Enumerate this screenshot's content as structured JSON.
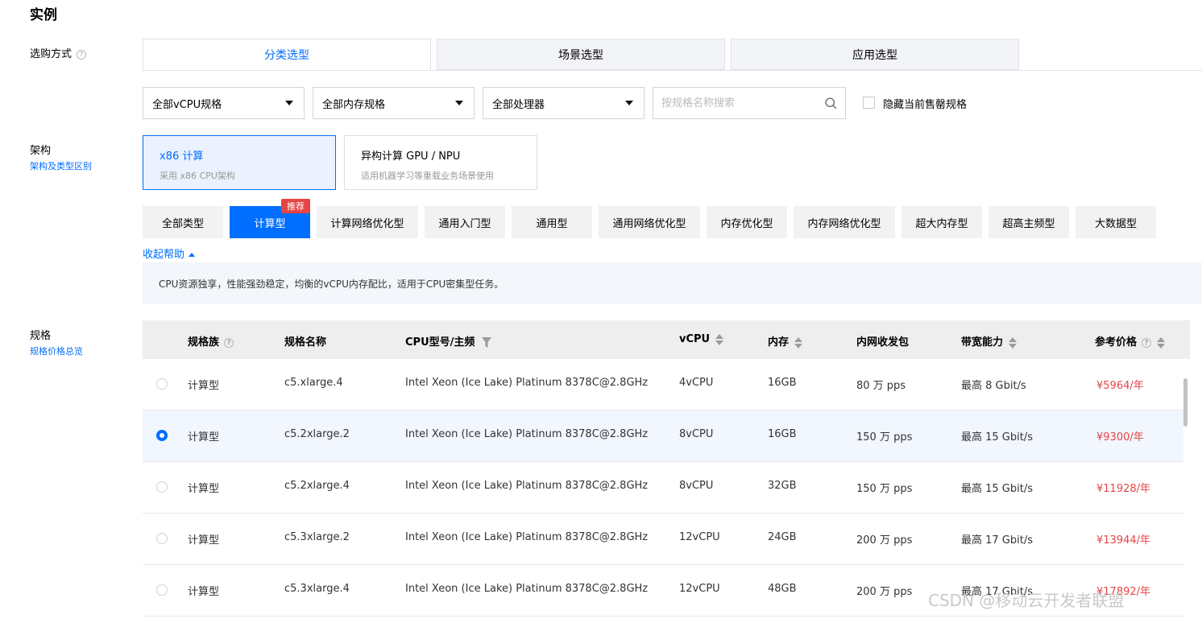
{
  "page_title": "实例",
  "purchase_mode": {
    "label": "选购方式",
    "help_icon": "question-circle-icon",
    "tabs": [
      {
        "label": "分类选型",
        "active": true
      },
      {
        "label": "场景选型",
        "active": false
      },
      {
        "label": "应用选型",
        "active": false
      }
    ]
  },
  "filters": {
    "vcpu": "全部vCPU规格",
    "memory": "全部内存规格",
    "processor": "全部处理器",
    "search_placeholder": "按规格名称搜索",
    "hide_sold_out": "隐藏当前售罄规格"
  },
  "architecture": {
    "label": "架构",
    "link": "架构及类型区别",
    "cards": [
      {
        "title": "x86 计算",
        "desc": "采用 x86 CPU架构",
        "active": true
      },
      {
        "title": "异构计算 GPU / NPU",
        "desc": "适用机器学习等重载业务场景使用",
        "active": false
      }
    ]
  },
  "types": {
    "badge": "推荐",
    "items": [
      "全部类型",
      "计算型",
      "计算网络优化型",
      "通用入门型",
      "通用型",
      "通用网络优化型",
      "内存优化型",
      "内存网络优化型",
      "超大内存型",
      "超高主频型",
      "大数据型"
    ],
    "active_index": 1,
    "collapse_help": "收起帮助",
    "help_text": "CPU资源独享，性能强劲稳定，均衡的vCPU内存配比，适用于CPU密集型任务。"
  },
  "spec": {
    "label": "规格",
    "link": "规格价格总览",
    "columns": [
      "规格族",
      "规格名称",
      "CPU型号/主频",
      "vCPU",
      "内存",
      "内网收发包",
      "带宽能力",
      "参考价格"
    ],
    "rows": [
      {
        "family": "计算型",
        "name": "c5.xlarge.4",
        "cpu": "Intel Xeon (Ice Lake) Platinum 8378C@2.8GHz",
        "vcpu": "4vCPU",
        "mem": "16GB",
        "pps": "80 万 pps",
        "bw": "最高 8 Gbit/s",
        "price": "¥5964/年",
        "selected": false
      },
      {
        "family": "计算型",
        "name": "c5.2xlarge.2",
        "cpu": "Intel Xeon (Ice Lake) Platinum 8378C@2.8GHz",
        "vcpu": "8vCPU",
        "mem": "16GB",
        "pps": "150 万 pps",
        "bw": "最高 15 Gbit/s",
        "price": "¥9300/年",
        "selected": true
      },
      {
        "family": "计算型",
        "name": "c5.2xlarge.4",
        "cpu": "Intel Xeon (Ice Lake) Platinum 8378C@2.8GHz",
        "vcpu": "8vCPU",
        "mem": "32GB",
        "pps": "150 万 pps",
        "bw": "最高 15 Gbit/s",
        "price": "¥11928/年",
        "selected": false
      },
      {
        "family": "计算型",
        "name": "c5.3xlarge.2",
        "cpu": "Intel Xeon (Ice Lake) Platinum 8378C@2.8GHz",
        "vcpu": "12vCPU",
        "mem": "24GB",
        "pps": "200 万 pps",
        "bw": "最高 17 Gbit/s",
        "price": "¥13944/年",
        "selected": false
      },
      {
        "family": "计算型",
        "name": "c5.3xlarge.4",
        "cpu": "Intel Xeon (Ice Lake) Platinum 8378C@2.8GHz",
        "vcpu": "12vCPU",
        "mem": "48GB",
        "pps": "200 万 pps",
        "bw": "最高 17 Gbit/s",
        "price": "¥17892/年",
        "selected": false
      }
    ]
  },
  "watermark": "CSDN @移动云开发者联盟",
  "colors": {
    "accent": "#006eff",
    "price": "#e54545",
    "badge": "#e54545"
  }
}
